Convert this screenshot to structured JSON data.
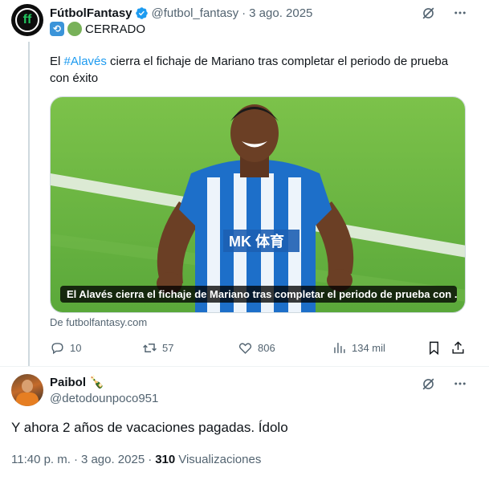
{
  "tweet": {
    "author_name": "FútbolFantasy",
    "handle": "@futbol_fantasy",
    "separator": "·",
    "date": "3 ago. 2025",
    "status_emojis": [
      "repeat-emoji",
      "green-circle-emoji"
    ],
    "status_text": "CERRADO",
    "text_prefix": "El ",
    "hashtag": "#Alavés",
    "text_suffix": " cierra el fichaje de Mariano tras completar el periodo de prueba con éxito",
    "card": {
      "caption": "El Alavés cierra el fichaje de Mariano tras completar el periodo de prueba con ...",
      "source": "De futbolfantasy.com"
    },
    "actions": {
      "replies": "10",
      "reposts": "57",
      "likes": "806",
      "views": "134 mil"
    },
    "icons": [
      "grok-icon",
      "more-icon",
      "reply-icon",
      "repost-icon",
      "like-icon",
      "views-icon",
      "bookmark-icon",
      "share-icon"
    ]
  },
  "reply": {
    "author_name": "Paibol",
    "name_emoji": "🍾",
    "handle": "@detodounpoco951",
    "text": "Y ahora 2 años de vacaciones pagadas. Ídolo",
    "time": "11:40 p. m.",
    "separator": "·",
    "date": "3 ago. 2025",
    "views_count": "310",
    "views_label": "Visualizaciones"
  },
  "colors": {
    "accent": "#1d9bf0",
    "secondary_text": "#536471",
    "primary_text": "#0f1419",
    "divider": "#eff3f4"
  }
}
